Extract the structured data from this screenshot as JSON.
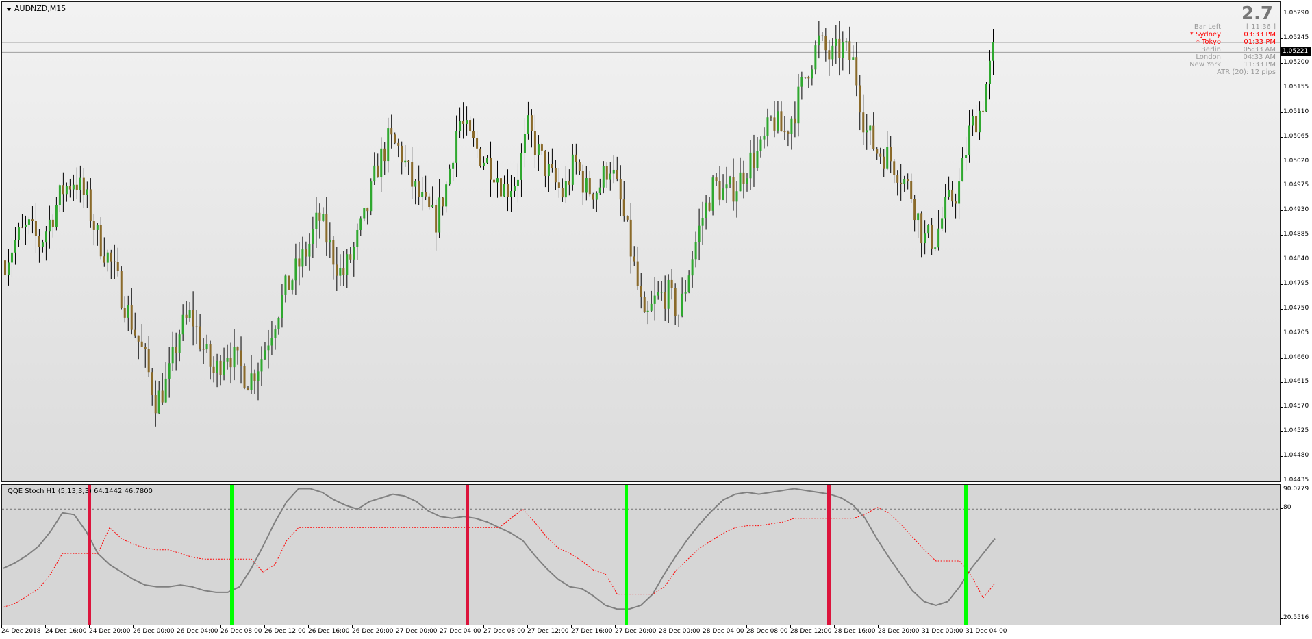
{
  "window": {
    "symbol_title": "AUDNZD,M15",
    "indicator_title": "QQE Stoch  H1 (5,13,3,3) 64.1442 46.7800",
    "big_value": "2.7"
  },
  "info_panel": [
    {
      "label": "Bar Left",
      "value": "[ 11:36 ]",
      "color": "#9a9a9a"
    },
    {
      "label": "* Sydney",
      "value": "03:33 PM",
      "color": "#ff0000"
    },
    {
      "label": "* Tokyo",
      "value": "01:33 PM",
      "color": "#ff0000"
    },
    {
      "label": "Berlin",
      "value": "05:33 AM",
      "color": "#9a9a9a"
    },
    {
      "label": "London",
      "value": "04:33 AM",
      "color": "#9a9a9a"
    },
    {
      "label": "New York",
      "value": "11:33 PM",
      "color": "#9a9a9a"
    },
    {
      "label": "ATR (20): 12 pips",
      "value": "",
      "color": "#9a9a9a"
    }
  ],
  "price_axis": {
    "ticks": [
      "1.05290",
      "1.05245",
      "1.05200",
      "1.05155",
      "1.05110",
      "1.05065",
      "1.05020",
      "1.04975",
      "1.04930",
      "1.04885",
      "1.04840",
      "1.04795",
      "1.04750",
      "1.04705",
      "1.04660",
      "1.04615",
      "1.04570",
      "1.04525",
      "1.04480",
      "1.04435"
    ],
    "current_price": "1.05221",
    "ask_line": "1.05239"
  },
  "indicator_axis": {
    "max_label": "90.0779",
    "level_label": "80",
    "min_label": "20.5516"
  },
  "time_axis": [
    "24 Dec 2018",
    "24 Dec 16:00",
    "24 Dec 20:00",
    "26 Dec 00:00",
    "26 Dec 04:00",
    "26 Dec 08:00",
    "26 Dec 12:00",
    "26 Dec 16:00",
    "26 Dec 20:00",
    "27 Dec 00:00",
    "27 Dec 04:00",
    "27 Dec 08:00",
    "27 Dec 12:00",
    "27 Dec 16:00",
    "27 Dec 20:00",
    "28 Dec 00:00",
    "28 Dec 04:00",
    "28 Dec 08:00",
    "28 Dec 12:00",
    "28 Dec 16:00",
    "28 Dec 20:00",
    "31 Dec 00:00",
    "31 Dec 04:00"
  ],
  "colors": {
    "bull_candle": "#2fa82f",
    "bear_candle": "#8a6a2a",
    "wick": "#000000",
    "stoch_line": "#808080",
    "signal_line": "#ff0000",
    "sell_bar": "#dc143c",
    "buy_bar": "#00ff00"
  },
  "chart_data": [
    {
      "type": "candlestick",
      "title": "AUDNZD,M15",
      "ylim": [
        1.04435,
        1.05313
      ],
      "path_closes": [
        1.0484,
        1.0488,
        1.049,
        1.0487,
        1.0492,
        1.0497,
        1.0499,
        1.0495,
        1.0488,
        1.0484,
        1.0478,
        1.0472,
        1.0466,
        1.0458,
        1.0462,
        1.0471,
        1.0474,
        1.0468,
        1.0463,
        1.0468,
        1.0465,
        1.0462,
        1.0466,
        1.0472,
        1.0478,
        1.0482,
        1.0486,
        1.0492,
        1.0486,
        1.0481,
        1.0486,
        1.0492,
        1.0501,
        1.0506,
        1.0504,
        1.0498,
        1.0494,
        1.0491,
        1.0498,
        1.051,
        1.0506,
        1.0503,
        1.0501,
        1.0497,
        1.0499,
        1.0508,
        1.0503,
        1.0499,
        1.0496,
        1.0502,
        1.0497,
        1.0497,
        1.0502,
        1.0494,
        1.0484,
        1.0472,
        1.0477,
        1.0478,
        1.0474,
        1.0484,
        1.0492,
        1.0498,
        1.0496,
        1.0498,
        1.0502,
        1.0504,
        1.051,
        1.0507,
        1.0512,
        1.0519,
        1.0524,
        1.0521,
        1.0523,
        1.052,
        1.0508,
        1.0504,
        1.0503,
        1.05,
        1.0496,
        1.0488,
        1.0488,
        1.0494,
        1.0497,
        1.0508,
        1.0512,
        1.0522
      ],
      "signals": [
        {
          "x": "24 Dec 20:00",
          "type": "sell"
        },
        {
          "x": "26 Dec 09:00",
          "type": "buy"
        },
        {
          "x": "27 Dec 06:30",
          "type": "sell"
        },
        {
          "x": "27 Dec 21:00",
          "type": "buy"
        },
        {
          "x": "28 Dec 15:30",
          "type": "sell"
        },
        {
          "x": "31 Dec 04:00",
          "type": "buy"
        }
      ]
    },
    {
      "type": "line",
      "title": "QQE Stoch  H1 (5,13,3,3) 64.1442 46.7800",
      "ylim": [
        20.5516,
        90.0779
      ],
      "levels": [
        80
      ],
      "series": [
        {
          "values": [
            48,
            51,
            55,
            60,
            68,
            78,
            77,
            68,
            56,
            50,
            46,
            42,
            39,
            38,
            38,
            39,
            38,
            36,
            35,
            35,
            38,
            48,
            60,
            73,
            84,
            91,
            91,
            89,
            85,
            82,
            80,
            84,
            86,
            88,
            87,
            84,
            79,
            76,
            75,
            76,
            75,
            73,
            70,
            67,
            63,
            55,
            48,
            42,
            38,
            37,
            33,
            28,
            26,
            26,
            28,
            34,
            45,
            55,
            64,
            72,
            79,
            85,
            88,
            89,
            88,
            89,
            90,
            91,
            90,
            89,
            88,
            86,
            82,
            75,
            64,
            54,
            45,
            36,
            30,
            28,
            30,
            38,
            48,
            56,
            64
          ]
        },
        {
          "values": [
            27,
            29,
            33,
            37,
            45,
            56,
            56,
            56,
            56,
            70,
            64,
            61,
            59,
            58,
            58,
            56,
            54,
            53,
            53,
            53,
            53,
            53,
            46,
            50,
            63,
            70,
            70,
            70,
            70,
            70,
            70,
            70,
            70,
            70,
            70,
            70,
            70,
            70,
            70,
            70,
            70,
            70,
            70,
            75,
            80,
            73,
            65,
            59,
            56,
            52,
            47,
            45,
            34,
            34,
            34,
            34,
            38,
            47,
            53,
            59,
            63,
            67,
            70,
            71,
            71,
            72,
            73,
            75,
            75,
            75,
            75,
            75,
            75,
            77,
            81,
            78,
            72,
            65,
            58,
            52,
            52,
            52,
            44,
            32,
            40
          ]
        }
      ]
    }
  ]
}
